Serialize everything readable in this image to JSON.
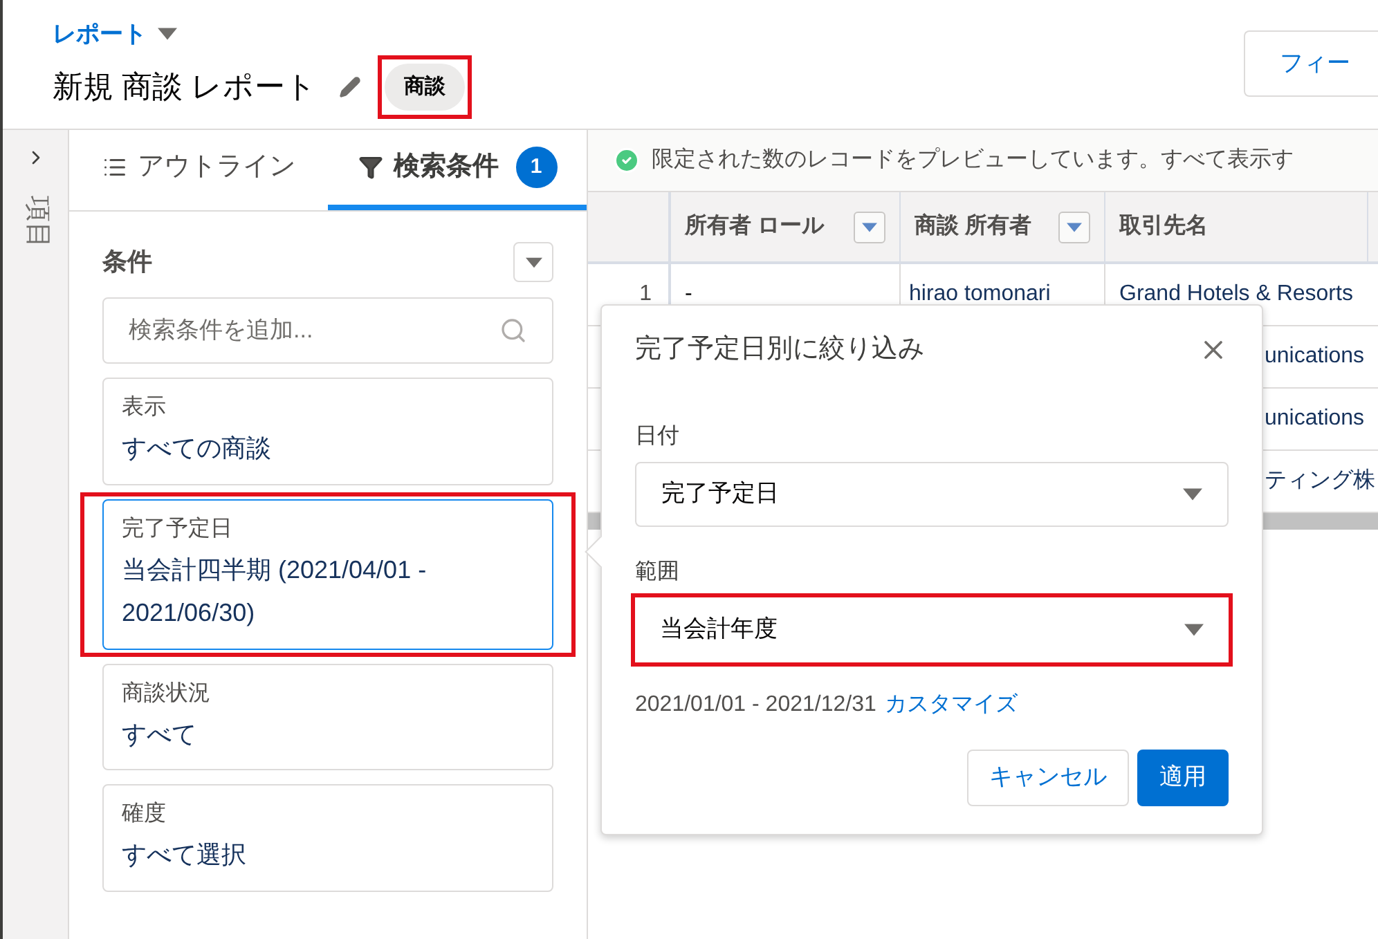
{
  "header": {
    "breadcrumb": "レポート",
    "title": "新規 商談 レポート",
    "type_badge": {
      "label": "商談",
      "highlighted": true
    },
    "top_button": "フィー"
  },
  "rail": {
    "label": "項目"
  },
  "tabs": [
    {
      "label": "アウトライン",
      "selected": false,
      "kind": "list"
    },
    {
      "label": "検索条件",
      "selected": true,
      "kind": "filter",
      "count": "1"
    }
  ],
  "filters": {
    "heading": "条件",
    "search_placeholder": "検索条件を追加...",
    "items": [
      {
        "label": "表示",
        "value": "すべての商談",
        "selected": false,
        "highlighted": false
      },
      {
        "label": "完了予定日",
        "value": "当会計四半期 (2021/04/01 - 2021/06/30)",
        "selected": true,
        "highlighted": true
      },
      {
        "label": "商談状況",
        "value": "すべて",
        "selected": false,
        "highlighted": false
      },
      {
        "label": "確度",
        "value": "すべて選択",
        "selected": false,
        "highlighted": false
      }
    ]
  },
  "preview_notice": "限定された数のレコードをプレビューしています。すべて表示す",
  "table": {
    "columns": [
      {
        "label": "所有者 ロール",
        "menu": true
      },
      {
        "label": "商談 所有者",
        "menu": true
      },
      {
        "label": "取引先名",
        "menu": false
      }
    ],
    "rows": [
      {
        "number": "1",
        "role": "-",
        "owner": "hirao tomonari",
        "account": "Grand Hotels & Resorts"
      },
      {
        "account": "unications"
      },
      {
        "account": "unications"
      },
      {
        "account": "ティング株"
      }
    ]
  },
  "popover": {
    "title": "完了予定日別に絞り込み",
    "fields": [
      {
        "label": "日付",
        "value": "完了予定日",
        "highlighted": false
      },
      {
        "label": "範囲",
        "value": "当会計年度",
        "highlighted": true
      }
    ],
    "range_text": "2021/01/01 - 2021/12/31",
    "customize_link": "カスタマイズ",
    "buttons": [
      {
        "label": "キャンセル",
        "kind": "neutral"
      },
      {
        "label": "適用",
        "kind": "brand"
      }
    ]
  }
}
